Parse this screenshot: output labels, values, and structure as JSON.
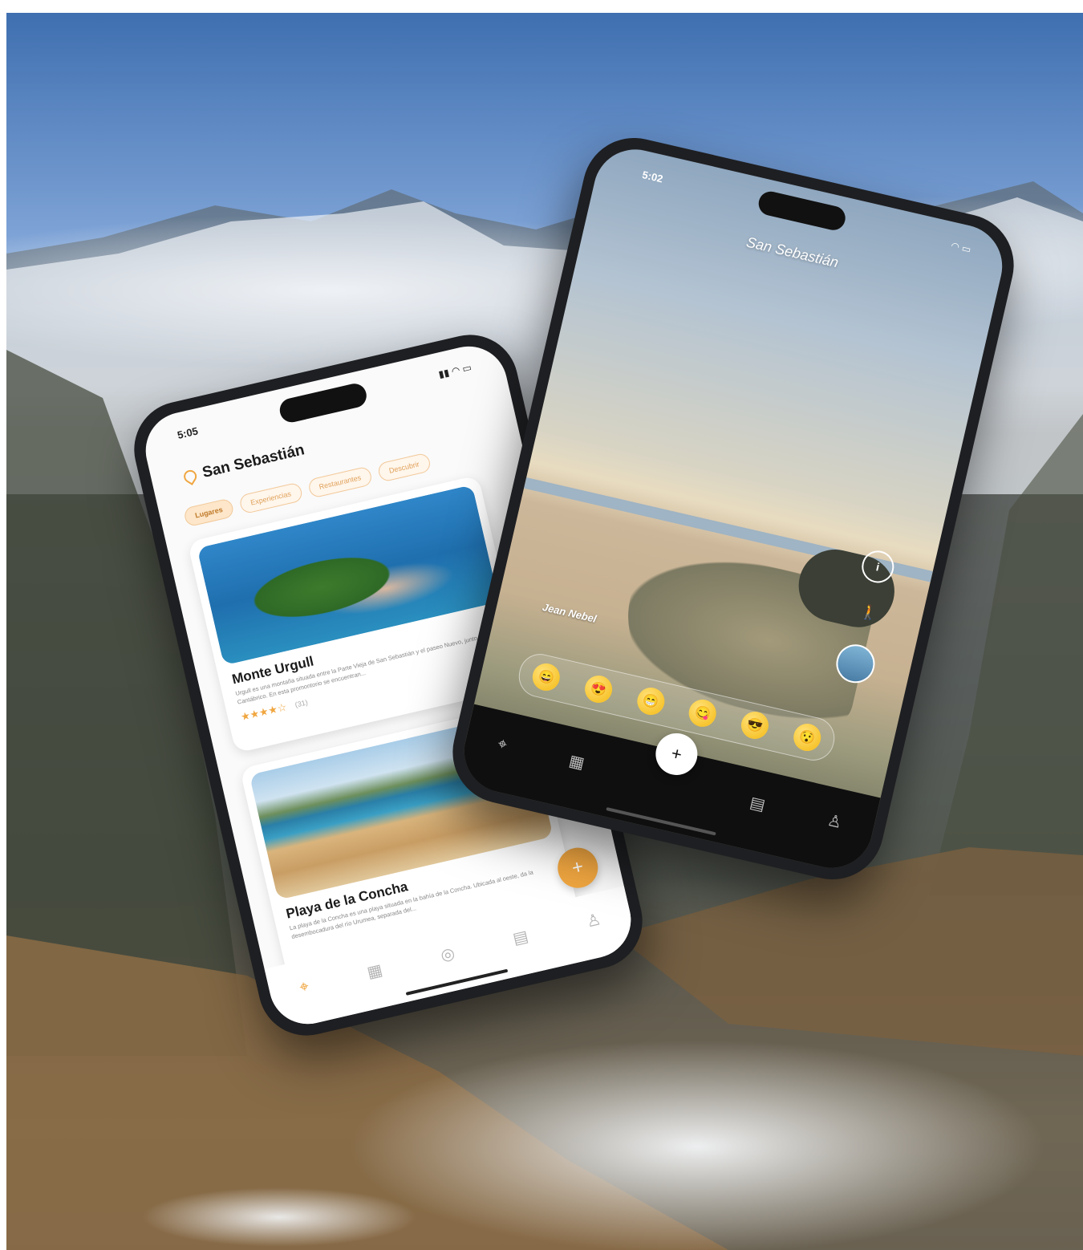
{
  "phone_left": {
    "status_time": "5:05",
    "status_icons": "▮▮ ◠ ▭",
    "location_title": "San Sebastián",
    "chips": [
      "Lugares",
      "Experiencias",
      "Restaurantes",
      "Descubrir"
    ],
    "cards": [
      {
        "title": "Monte Urgull",
        "description": "Urgull es una montaña situada entre la Parte Vieja de San Sebastián y el paseo Nuevo, junto al mar Cantábrico. En esta promontorio se encuentran...",
        "stars": "★★★★☆",
        "rating_count": "(31)"
      },
      {
        "title": "Playa de la Concha",
        "description": "La playa de la Concha es una playa situada en la bahía de la Concha. Ubicada al oeste, da la desembocadura del río Urumea, separada del..."
      }
    ],
    "fab_icon": "+",
    "tabs": [
      {
        "icon": "location-pin-icon",
        "glyph": "⌖"
      },
      {
        "icon": "calendar-icon",
        "glyph": "▦"
      },
      {
        "icon": "compass-icon",
        "glyph": "◎"
      },
      {
        "icon": "chat-icon",
        "glyph": "▤"
      },
      {
        "icon": "profile-icon",
        "glyph": "♙"
      }
    ]
  },
  "phone_right": {
    "status_time": "5:02",
    "status_icons": "◠ ▭",
    "location_title": "San Sebastián",
    "author_name": "Jean Nebel",
    "side_buttons": {
      "info": "i",
      "walk": "🚶"
    },
    "reactions": [
      "😄",
      "😍",
      "😁",
      "😋",
      "😎",
      "😯"
    ],
    "fab_icon": "+",
    "tabs": [
      {
        "icon": "location-pin-icon",
        "glyph": "⌖"
      },
      {
        "icon": "calendar-icon",
        "glyph": "▦"
      },
      {
        "icon": "chat-icon",
        "glyph": "▤"
      },
      {
        "icon": "profile-icon",
        "glyph": "♙"
      }
    ]
  }
}
